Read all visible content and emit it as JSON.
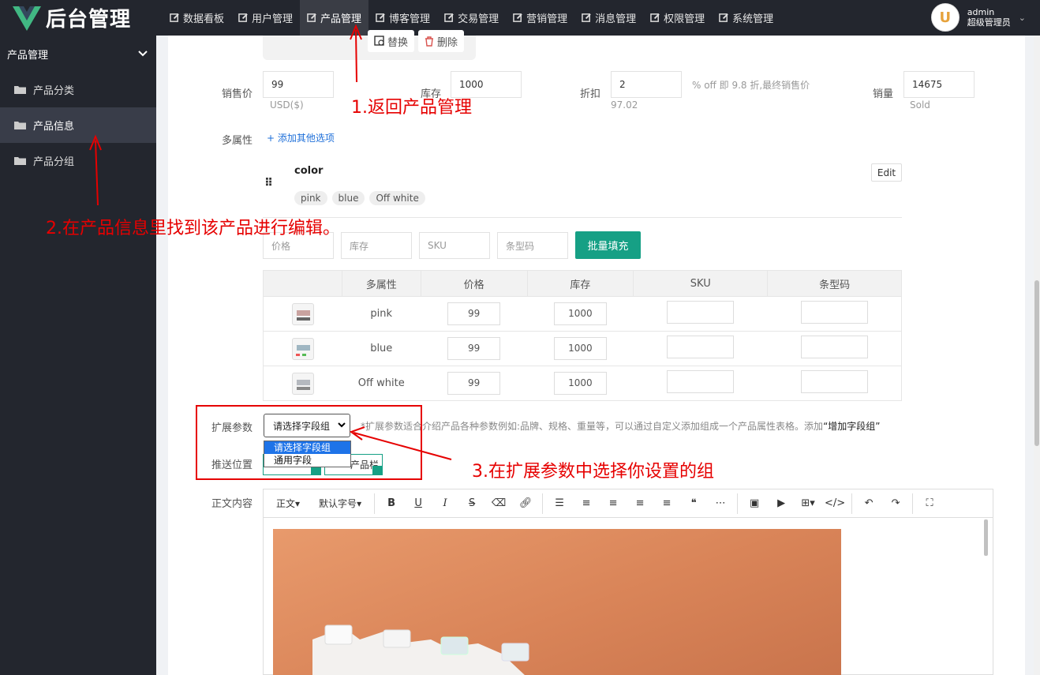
{
  "header": {
    "brand": "后台管理",
    "nav": [
      {
        "label": "数据看板"
      },
      {
        "label": "用户管理"
      },
      {
        "label": "产品管理"
      },
      {
        "label": "博客管理"
      },
      {
        "label": "交易管理"
      },
      {
        "label": "营销管理"
      },
      {
        "label": "消息管理"
      },
      {
        "label": "权限管理"
      },
      {
        "label": "系统管理"
      }
    ],
    "active_nav": "产品管理",
    "user": {
      "avatar_letter": "U",
      "name": "admin",
      "role": "超级管理员"
    }
  },
  "sidebar": {
    "section": "产品管理",
    "items": [
      {
        "label": "产品分类"
      },
      {
        "label": "产品信息"
      },
      {
        "label": "产品分组"
      }
    ],
    "active_item": "产品信息"
  },
  "image_actions": {
    "replace": "替换",
    "delete": "删除"
  },
  "pricing": {
    "price_label": "销售价",
    "price_value": "99",
    "price_unit": "USD($)",
    "stock_label": "库存",
    "stock_value": "1000",
    "discount_label": "折扣",
    "discount_value": "2",
    "discount_hint": "% off 即 9.8 折,最终销售价",
    "discount_final": "97.02",
    "sales_label": "销量",
    "sales_value": "14675",
    "sales_unit": "Sold"
  },
  "attributes": {
    "label": "多属性",
    "add_option": "添加其他选项",
    "group_name": "color",
    "tags": [
      "pink",
      "blue",
      "Off white"
    ],
    "edit": "Edit"
  },
  "batch": {
    "price_ph": "价格",
    "stock_ph": "库存",
    "sku_ph": "SKU",
    "barcode_ph": "条型码",
    "fill_button": "批量填充"
  },
  "sku_table": {
    "headers": [
      "多属性",
      "价格",
      "库存",
      "SKU",
      "条型码"
    ],
    "rows": [
      {
        "name": "pink",
        "price": "99",
        "stock": "1000",
        "sku": "",
        "barcode": ""
      },
      {
        "name": "blue",
        "price": "99",
        "stock": "1000",
        "sku": "",
        "barcode": ""
      },
      {
        "name": "Off white",
        "price": "99",
        "stock": "1000",
        "sku": "",
        "barcode": ""
      }
    ]
  },
  "extension": {
    "label": "扩展参数",
    "select_value": "请选择字段组",
    "options": [
      "请选择字段组",
      "通用字段"
    ],
    "hint_prefix": "*扩展参数适合介绍产品各种参数例如:品牌、规格、重量等，可以通过自定义添加组成一个产品属性表格。添加",
    "hint_bold": "“增加字段组”"
  },
  "push": {
    "label": "推送位置",
    "option2": "产品栏"
  },
  "content": {
    "label": "正文内容",
    "format": "正文",
    "font_size": "默认字号"
  },
  "annotations": {
    "step1": "1.返回产品管理",
    "step2": "2.在产品信息里找到该产品进行编辑。",
    "step3": "3.在扩展参数中选择你设置的组"
  },
  "colors": {
    "accent": "#16a085",
    "annotation": "#e60000",
    "dark": "#23262e"
  }
}
